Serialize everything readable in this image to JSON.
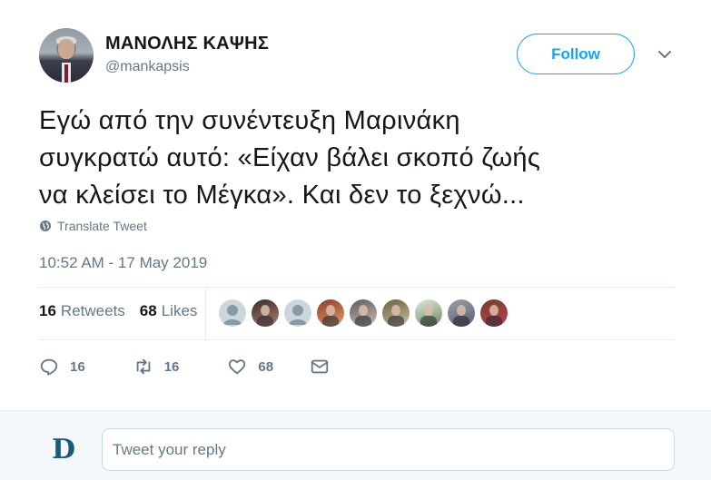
{
  "author": {
    "name": "ΜΑΝΟΛΗΣ ΚΑΨΗΣ",
    "handle": "@mankapsis"
  },
  "follow_button": {
    "label": "Follow"
  },
  "tweet": {
    "lines": [
      "Εγώ από την συνέντευξη Μαρινάκη",
      "συγκρατώ αυτό: «Είχαν βάλει σκοπό ζωής",
      "να κλείσει το Μέγκα». Και δεν το ξεχνώ..."
    ],
    "translate_label": "Translate Tweet",
    "timestamp": "10:52 AM - 17 May 2019"
  },
  "stats": {
    "retweets_count": "16",
    "retweets_label": "Retweets",
    "likes_count": "68",
    "likes_label": "Likes"
  },
  "likers": [
    {
      "type": "default"
    },
    {
      "type": "photo",
      "colors": [
        "#3a2a2a",
        "#b08070"
      ]
    },
    {
      "type": "default"
    },
    {
      "type": "photo",
      "colors": [
        "#8a3b2b",
        "#e0a070"
      ]
    },
    {
      "type": "photo",
      "colors": [
        "#5a5a60",
        "#d0c0b0"
      ]
    },
    {
      "type": "photo",
      "colors": [
        "#6b6040",
        "#c8c0a0"
      ]
    },
    {
      "type": "photo",
      "colors": [
        "#e0e8e0",
        "#6a8a5a"
      ]
    },
    {
      "type": "photo",
      "colors": [
        "#9aa0a8",
        "#5a6070"
      ]
    },
    {
      "type": "photo",
      "colors": [
        "#704030",
        "#c04050"
      ]
    }
  ],
  "actions": {
    "reply_count": "16",
    "retweet_count": "16",
    "like_count": "68"
  },
  "reply": {
    "placeholder": "Tweet your reply"
  },
  "colors": {
    "accent": "#1da1f2",
    "muted": "#657786",
    "text": "#14171a"
  }
}
